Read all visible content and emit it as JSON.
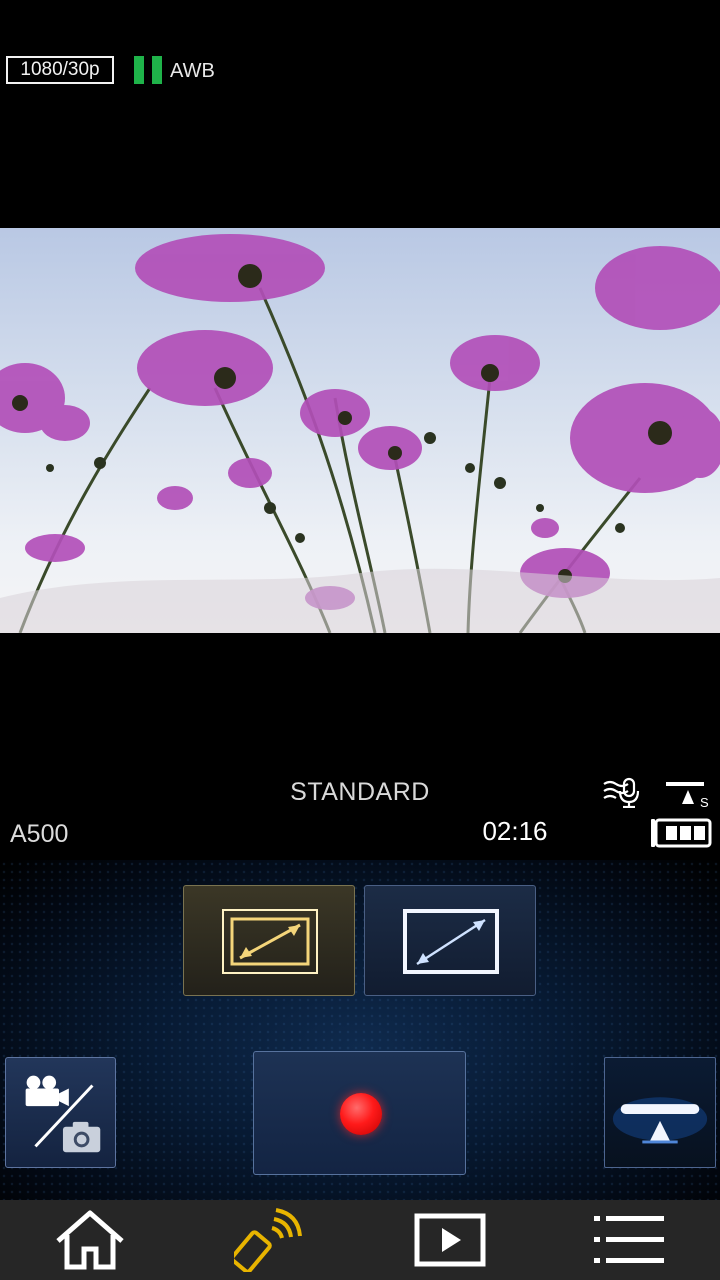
{
  "status": {
    "resolution": "1080/30p",
    "white_balance": "AWB"
  },
  "info": {
    "scene_mode": "STANDARD",
    "camera_model": "A500",
    "remaining_time": "02:16",
    "battery_level_bars": 3
  },
  "icons": {
    "wind_mic": "wind-cut-mic-icon",
    "tele_macro": "tele-macro-icon",
    "battery": "battery-icon",
    "aspect_gold": "aspect-wide-icon",
    "aspect_blue": "aspect-wide-icon",
    "mode": "video-photo-switch-icon",
    "record": "record-icon",
    "zoom": "zoom-lever-icon",
    "home": "home-icon",
    "wifi": "wifi-remote-icon",
    "playback": "play-icon",
    "menu": "menu-icon"
  },
  "colors": {
    "record_red": "#ff1a1a",
    "level_green": "#1fb34a",
    "gold_accent": "#f4d57a",
    "blue_accent": "#9ec8ff",
    "wifi_gold": "#e8b400"
  }
}
